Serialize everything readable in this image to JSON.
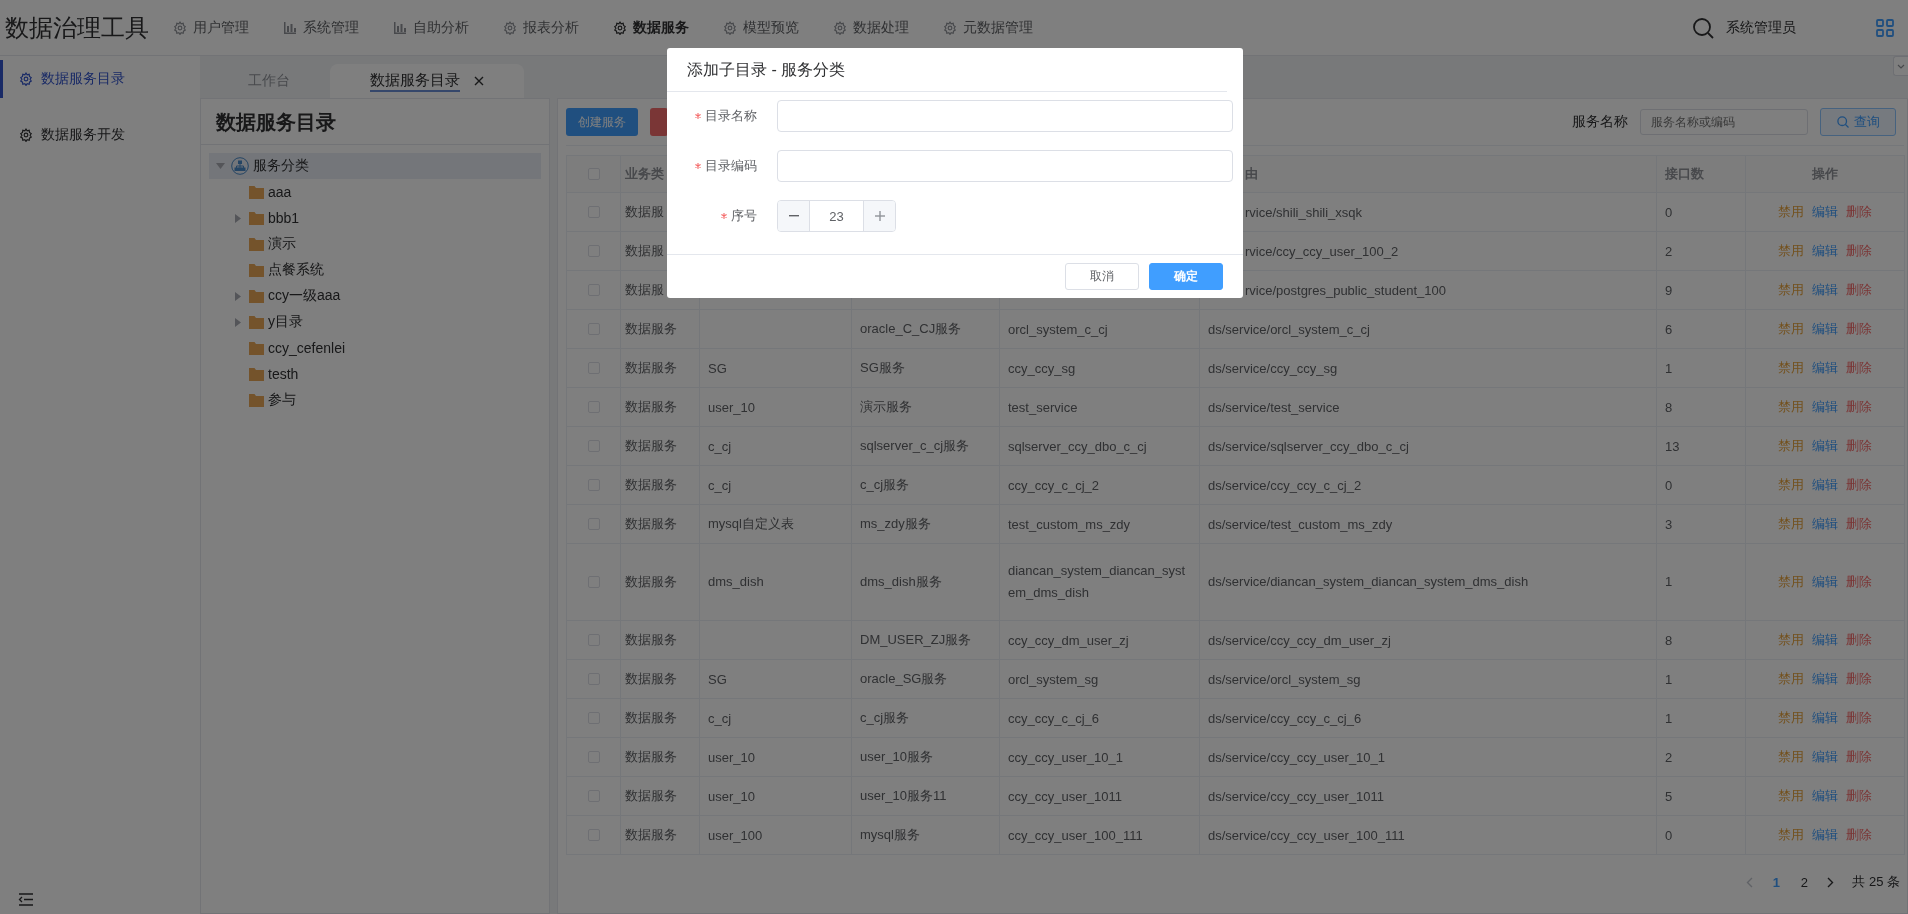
{
  "app": {
    "title": "数据治理工具"
  },
  "menu": [
    {
      "label": "用户管理",
      "selected": false
    },
    {
      "label": "系统管理",
      "selected": false
    },
    {
      "label": "自助分析",
      "selected": false
    },
    {
      "label": "报表分析",
      "selected": false
    },
    {
      "label": "数据服务",
      "selected": true
    },
    {
      "label": "模型预览",
      "selected": false
    },
    {
      "label": "数据处理",
      "selected": false
    },
    {
      "label": "元数据管理",
      "selected": false
    }
  ],
  "user": {
    "name": "系统管理员"
  },
  "sidebar": {
    "items": [
      {
        "label": "数据服务目录",
        "selected": true
      },
      {
        "label": "数据服务开发",
        "selected": false
      }
    ]
  },
  "tabs": [
    {
      "label": "工作台",
      "selected": false,
      "closable": false
    },
    {
      "label": "数据服务目录",
      "selected": true,
      "closable": true
    }
  ],
  "tree": {
    "title": "数据服务目录",
    "nodes": [
      {
        "label": "服务分类",
        "kind": "root",
        "selected": true,
        "expanded": true,
        "children": [
          {
            "label": "aaa",
            "kind": "folder",
            "selected": false,
            "expanded": false,
            "has_children": false
          },
          {
            "label": "bbb1",
            "kind": "folder",
            "selected": false,
            "expanded": false,
            "has_children": true
          },
          {
            "label": "演示",
            "kind": "folder",
            "selected": false,
            "expanded": false,
            "has_children": false
          },
          {
            "label": "点餐系统",
            "kind": "folder",
            "selected": false,
            "expanded": false,
            "has_children": false
          },
          {
            "label": "ccy一级aaa",
            "kind": "folder",
            "selected": false,
            "expanded": false,
            "has_children": true
          },
          {
            "label": "y目录",
            "kind": "folder",
            "selected": false,
            "expanded": false,
            "has_children": true
          },
          {
            "label": "ccy_cefenlei",
            "kind": "folder",
            "selected": false,
            "expanded": false,
            "has_children": false
          },
          {
            "label": "testh",
            "kind": "folder",
            "selected": false,
            "expanded": false,
            "has_children": false
          },
          {
            "label": "参与",
            "kind": "folder",
            "selected": false,
            "expanded": false,
            "has_children": false
          }
        ]
      }
    ]
  },
  "toolbar": {
    "buttons": [
      {
        "label": "创建服务",
        "kind": "primary"
      },
      {
        "kind": "danger"
      }
    ]
  },
  "search": {
    "label": "服务名称",
    "placeholder": "服务名称或编码",
    "button": "查询"
  },
  "table": {
    "header_checked": false,
    "columns": [
      "业务类",
      null,
      null,
      null,
      "由",
      "接口数",
      "操作"
    ],
    "rows": [
      {
        "checked": false,
        "cells": [
          "数据服",
          null,
          null,
          null,
          "rvice/shili_shili_xsqk",
          "0"
        ],
        "actions": [
          {
            "label": "禁用",
            "kind": "disable"
          },
          {
            "label": "编辑",
            "kind": "edit"
          },
          {
            "label": "删除",
            "kind": "delete"
          }
        ]
      },
      {
        "checked": false,
        "cells": [
          "数据服",
          null,
          null,
          null,
          "rvice/ccy_ccy_user_100_2",
          "2"
        ],
        "actions": [
          {
            "label": "禁用",
            "kind": "disable"
          },
          {
            "label": "编辑",
            "kind": "edit"
          },
          {
            "label": "删除",
            "kind": "delete"
          }
        ]
      },
      {
        "checked": false,
        "cells": [
          "数据服",
          null,
          null,
          null,
          "rvice/postgres_public_student_100",
          "9"
        ],
        "actions": [
          {
            "label": "禁用",
            "kind": "disable"
          },
          {
            "label": "编辑",
            "kind": "edit"
          },
          {
            "label": "删除",
            "kind": "delete"
          }
        ]
      },
      {
        "checked": false,
        "cells": [
          "数据服务",
          "",
          "oracle_C_CJ服务",
          "orcl_system_c_cj",
          "ds/service/orcl_system_c_cj",
          "6"
        ],
        "actions": [
          {
            "label": "禁用",
            "kind": "disable"
          },
          {
            "label": "编辑",
            "kind": "edit"
          },
          {
            "label": "删除",
            "kind": "delete"
          }
        ]
      },
      {
        "checked": false,
        "cells": [
          "数据服务",
          "SG",
          "SG服务",
          "ccy_ccy_sg",
          "ds/service/ccy_ccy_sg",
          "1"
        ],
        "actions": [
          {
            "label": "禁用",
            "kind": "disable"
          },
          {
            "label": "编辑",
            "kind": "edit"
          },
          {
            "label": "删除",
            "kind": "delete"
          }
        ]
      },
      {
        "checked": false,
        "cells": [
          "数据服务",
          "user_10",
          "演示服务",
          "test_service",
          "ds/service/test_service",
          "8"
        ],
        "actions": [
          {
            "label": "禁用",
            "kind": "disable"
          },
          {
            "label": "编辑",
            "kind": "edit"
          },
          {
            "label": "删除",
            "kind": "delete"
          }
        ]
      },
      {
        "checked": false,
        "cells": [
          "数据服务",
          "c_cj",
          "sqlserver_c_cj服务",
          "sqlserver_ccy_dbo_c_cj",
          "ds/service/sqlserver_ccy_dbo_c_cj",
          "13"
        ],
        "actions": [
          {
            "label": "禁用",
            "kind": "disable"
          },
          {
            "label": "编辑",
            "kind": "edit"
          },
          {
            "label": "删除",
            "kind": "delete"
          }
        ]
      },
      {
        "checked": false,
        "cells": [
          "数据服务",
          "c_cj",
          "c_cj服务",
          "ccy_ccy_c_cj_2",
          "ds/service/ccy_ccy_c_cj_2",
          "0"
        ],
        "actions": [
          {
            "label": "禁用",
            "kind": "disable"
          },
          {
            "label": "编辑",
            "kind": "edit"
          },
          {
            "label": "删除",
            "kind": "delete"
          }
        ]
      },
      {
        "checked": false,
        "cells": [
          "数据服务",
          "mysql自定义表",
          "ms_zdy服务",
          "test_custom_ms_zdy",
          "ds/service/test_custom_ms_zdy",
          "3"
        ],
        "actions": [
          {
            "label": "禁用",
            "kind": "disable"
          },
          {
            "label": "编辑",
            "kind": "edit"
          },
          {
            "label": "删除",
            "kind": "delete"
          }
        ]
      },
      {
        "checked": false,
        "cells": [
          "数据服务",
          "dms_dish",
          "dms_dish服务",
          "diancan_system_diancan_system_dms_dish",
          "ds/service/diancan_system_diancan_system_dms_dish",
          "1"
        ],
        "actions": [
          {
            "label": "禁用",
            "kind": "disable"
          },
          {
            "label": "编辑",
            "kind": "edit"
          },
          {
            "label": "删除",
            "kind": "delete"
          }
        ]
      },
      {
        "checked": false,
        "cells": [
          "数据服务",
          "",
          "DM_USER_ZJ服务",
          "ccy_ccy_dm_user_zj",
          "ds/service/ccy_ccy_dm_user_zj",
          "8"
        ],
        "actions": [
          {
            "label": "禁用",
            "kind": "disable"
          },
          {
            "label": "编辑",
            "kind": "edit"
          },
          {
            "label": "删除",
            "kind": "delete"
          }
        ]
      },
      {
        "checked": false,
        "cells": [
          "数据服务",
          "SG",
          "oracle_SG服务",
          "orcl_system_sg",
          "ds/service/orcl_system_sg",
          "1"
        ],
        "actions": [
          {
            "label": "禁用",
            "kind": "disable"
          },
          {
            "label": "编辑",
            "kind": "edit"
          },
          {
            "label": "删除",
            "kind": "delete"
          }
        ]
      },
      {
        "checked": false,
        "cells": [
          "数据服务",
          "c_cj",
          "c_cj服务",
          "ccy_ccy_c_cj_6",
          "ds/service/ccy_ccy_c_cj_6",
          "1"
        ],
        "actions": [
          {
            "label": "禁用",
            "kind": "disable"
          },
          {
            "label": "编辑",
            "kind": "edit"
          },
          {
            "label": "删除",
            "kind": "delete"
          }
        ]
      },
      {
        "checked": false,
        "cells": [
          "数据服务",
          "user_10",
          "user_10服务",
          "ccy_ccy_user_10_1",
          "ds/service/ccy_ccy_user_10_1",
          "2"
        ],
        "actions": [
          {
            "label": "禁用",
            "kind": "disable"
          },
          {
            "label": "编辑",
            "kind": "edit"
          },
          {
            "label": "删除",
            "kind": "delete"
          }
        ]
      },
      {
        "checked": false,
        "cells": [
          "数据服务",
          "user_10",
          "user_10服务11",
          "ccy_ccy_user_1011",
          "ds/service/ccy_ccy_user_1011",
          "5"
        ],
        "actions": [
          {
            "label": "禁用",
            "kind": "disable"
          },
          {
            "label": "编辑",
            "kind": "edit"
          },
          {
            "label": "删除",
            "kind": "delete"
          }
        ]
      },
      {
        "checked": false,
        "cells": [
          "数据服务",
          "user_100",
          "mysql服务",
          "ccy_ccy_user_100_111",
          "ds/service/ccy_ccy_user_100_111",
          "0"
        ],
        "actions": [
          {
            "label": "禁用",
            "kind": "disable"
          },
          {
            "label": "编辑",
            "kind": "edit"
          },
          {
            "label": "删除",
            "kind": "delete"
          }
        ]
      }
    ]
  },
  "pagination": {
    "pages": [
      {
        "label": "1",
        "selected": true
      },
      {
        "label": "2",
        "selected": false
      }
    ],
    "total": "共 25 条"
  },
  "dialog": {
    "title": "添加子目录 - 服务分类",
    "fields": [
      {
        "label": "目录名称",
        "required": true,
        "kind": "text"
      },
      {
        "label": "目录编码",
        "required": true,
        "kind": "text"
      },
      {
        "label": "序号",
        "required": true,
        "kind": "number",
        "value": "23"
      }
    ],
    "buttons": [
      {
        "label": "取消",
        "kind": "default"
      },
      {
        "label": "确定",
        "kind": "primary"
      }
    ]
  }
}
